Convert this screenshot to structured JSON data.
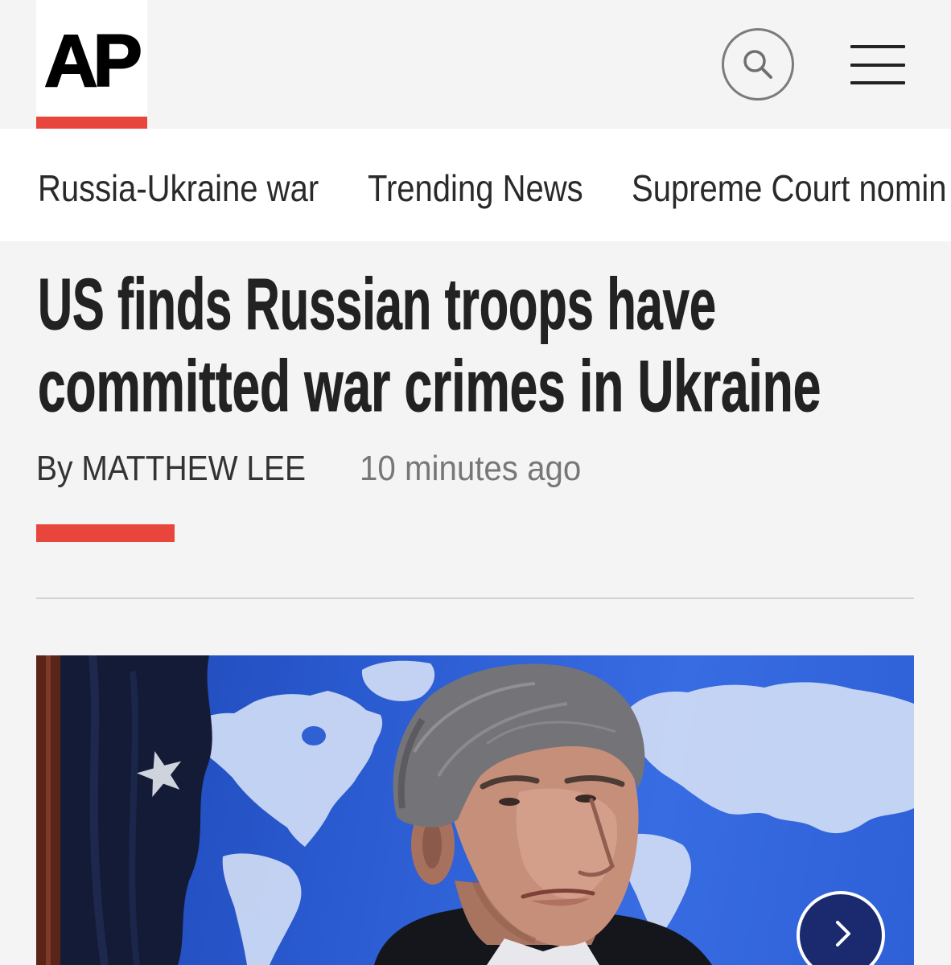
{
  "header": {
    "logo_text": "AP"
  },
  "nav": {
    "items": [
      {
        "label": "Russia-Ukraine war"
      },
      {
        "label": "Trending News"
      },
      {
        "label": "Supreme Court nomin"
      }
    ]
  },
  "article": {
    "headline_lines": [
      "US finds Russian troops have",
      "committed war crimes in Ukraine"
    ],
    "byline": "By MATTHEW LEE",
    "timestamp": "10 minutes ago"
  },
  "icons": {
    "search": "search-icon",
    "menu": "hamburger-menu-icon",
    "image_next": "chevron-right-icon"
  },
  "colors": {
    "brand_red": "#e8453c",
    "page_background": "#f4f4f4",
    "nav_background": "#ffffff",
    "headline_text": "#222222",
    "timestamp_text": "#777777"
  }
}
